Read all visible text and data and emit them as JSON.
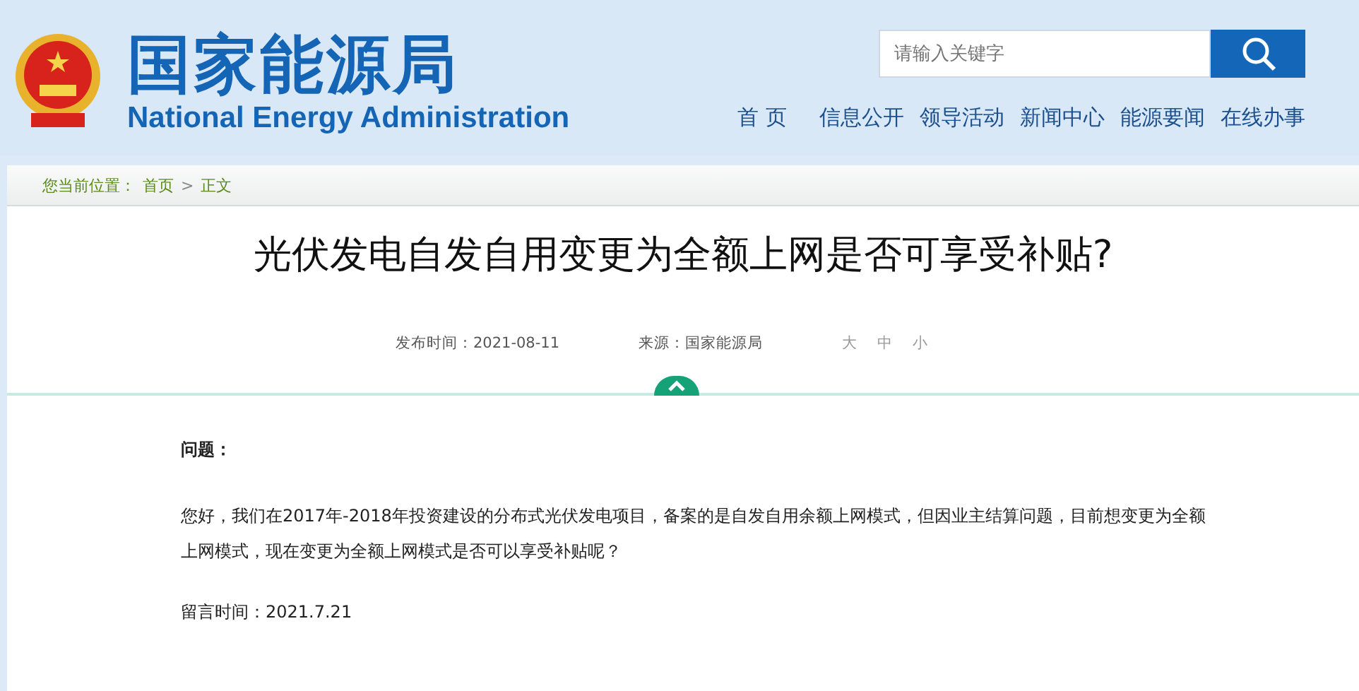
{
  "header": {
    "logo_cn": "国家能源局",
    "logo_en": "National Energy Administration"
  },
  "search": {
    "placeholder": "请输入关键字"
  },
  "nav": [
    "首 页",
    "信息公开",
    "领导活动",
    "新闻中心",
    "能源要闻",
    "在线办事"
  ],
  "breadcrumb": {
    "prefix": "您当前位置：",
    "items": [
      "首页",
      "正文"
    ],
    "separator": ">"
  },
  "article": {
    "title": "光伏发电自发自用变更为全额上网是否可享受补贴?",
    "published": "发布时间：2021-08-11",
    "source": "来源：国家能源局",
    "font_sizes": [
      "大",
      "中",
      "小"
    ],
    "question_label": "问题：",
    "question": "您好，我们在2017年-2018年投资建设的分布式光伏发电项目，备案的是自发自用余额上网模式，但因业主结算问题，目前想变更为全额上网模式，现在变更为全额上网模式是否可以享受补贴呢？",
    "message_time": "留言时间：2021.7.21"
  }
}
